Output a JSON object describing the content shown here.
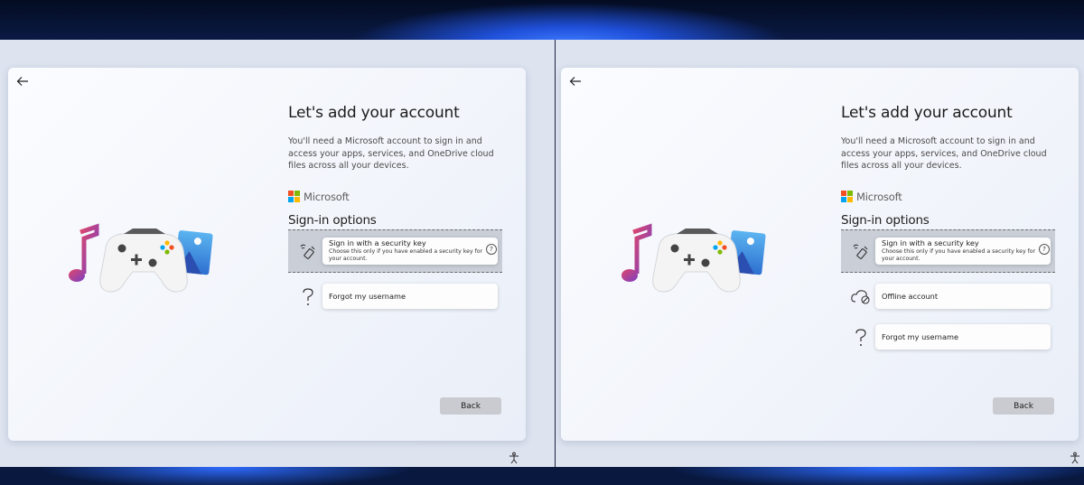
{
  "screens": [
    {
      "title": "Let's add your account",
      "description": "You'll need a Microsoft account to sign in and access your apps, services, and OneDrive cloud files across all your devices.",
      "brand": "Microsoft",
      "sign_in_heading": "Sign-in options",
      "options": [
        {
          "icon": "security-key-icon",
          "label": "Sign in with a security key",
          "sub": "Choose this only if you have enabled a security key for your account.",
          "selected": true
        },
        {
          "icon": "question-icon",
          "label": "Forgot my username",
          "selected": false
        }
      ],
      "back_label": "Back"
    },
    {
      "title": "Let's add your account",
      "description": "You'll need a Microsoft account to sign in and access your apps, services, and OneDrive cloud files across all your devices.",
      "brand": "Microsoft",
      "sign_in_heading": "Sign-in options",
      "options": [
        {
          "icon": "security-key-icon",
          "label": "Sign in with a security key",
          "sub": "Choose this only if you have enabled a security key for your account.",
          "selected": true
        },
        {
          "icon": "offline-cloud-icon",
          "label": "Offline account",
          "selected": false
        },
        {
          "icon": "question-icon",
          "label": "Forgot my username",
          "selected": false
        }
      ],
      "back_label": "Back"
    }
  ],
  "colors": {
    "ms_red": "#f25022",
    "ms_green": "#7fba00",
    "ms_blue": "#00a4ef",
    "ms_yellow": "#ffb900",
    "selected_row": "#c9ced7",
    "back_button": "#c9cbd0"
  }
}
